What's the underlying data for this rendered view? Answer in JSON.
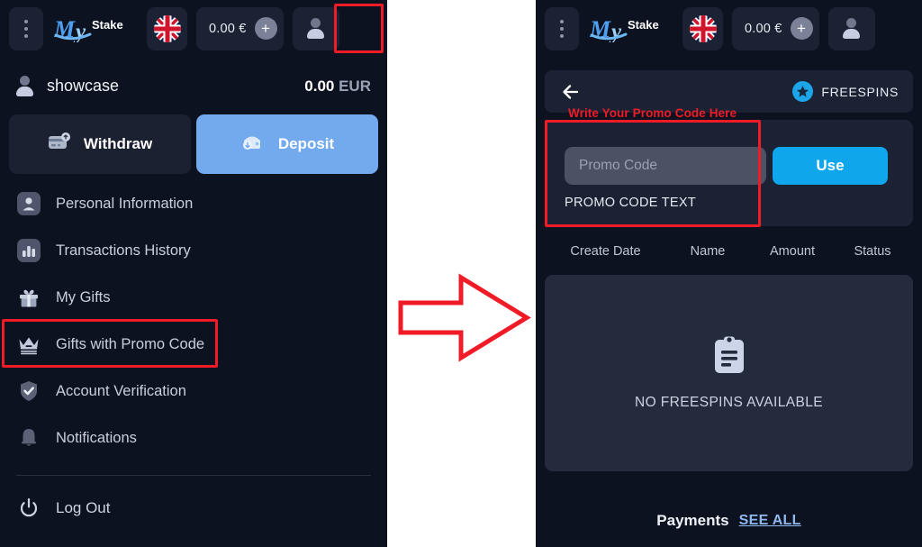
{
  "topbar": {
    "menu_icon": "three-dots-icon",
    "logo_my": "My",
    "logo_stake": "Stake",
    "flag_icon": "uk-flag-icon",
    "balance": "0.00 €",
    "add_funds_label": "+",
    "profile_icon": "user-avatar-icon"
  },
  "left_panel": {
    "account": {
      "username": "showcase",
      "balance_amount": "0.00",
      "balance_currency": "EUR"
    },
    "actions": [
      {
        "label": "Withdraw",
        "icon": "card-icon"
      },
      {
        "label": "Deposit",
        "icon": "wallet-icon"
      }
    ],
    "menu": [
      {
        "label": "Personal Information",
        "icon": "person-icon",
        "highlighted": false
      },
      {
        "label": "Transactions History",
        "icon": "bar-chart-icon",
        "highlighted": false
      },
      {
        "label": "My Gifts",
        "icon": "gift-icon",
        "highlighted": false
      },
      {
        "label": "Gifts with Promo Code",
        "icon": "crown-icon",
        "highlighted": true
      },
      {
        "label": "Account Verification",
        "icon": "shield-check-icon",
        "highlighted": false
      },
      {
        "label": "Notifications",
        "icon": "bell-icon",
        "highlighted": false
      }
    ],
    "logout": {
      "label": "Log Out",
      "icon": "power-icon"
    }
  },
  "right_panel": {
    "sub_header": {
      "back_icon": "arrow-left-icon",
      "badge_icon": "star-icon",
      "badge_label": "FREESPINS"
    },
    "annotation": "Write Your Promo Code Here",
    "promo": {
      "input_placeholder": "Promo Code",
      "input_value": "",
      "sub_label": "PROMO CODE TEXT",
      "use_button": "Use"
    },
    "table": {
      "columns": [
        "Create Date",
        "Name",
        "Amount",
        "Status"
      ],
      "rows": [],
      "empty_icon": "clipboard-icon",
      "empty_message": "NO FREESPINS AVAILABLE"
    },
    "footer": {
      "payments_label": "Payments",
      "see_all_label": "SEE ALL"
    }
  },
  "annotations": {
    "arrow_icon": "right-arrow-annotation",
    "highlight_color": "#ef1b26"
  },
  "colors": {
    "background": "#0d1220",
    "panel": "#1b2234",
    "card": "#242b3d",
    "accent_blue": "#0fa6ec",
    "deposit_blue": "#72aaed",
    "link_blue": "#8fb8ef",
    "highlight_red": "#ef1b26"
  }
}
